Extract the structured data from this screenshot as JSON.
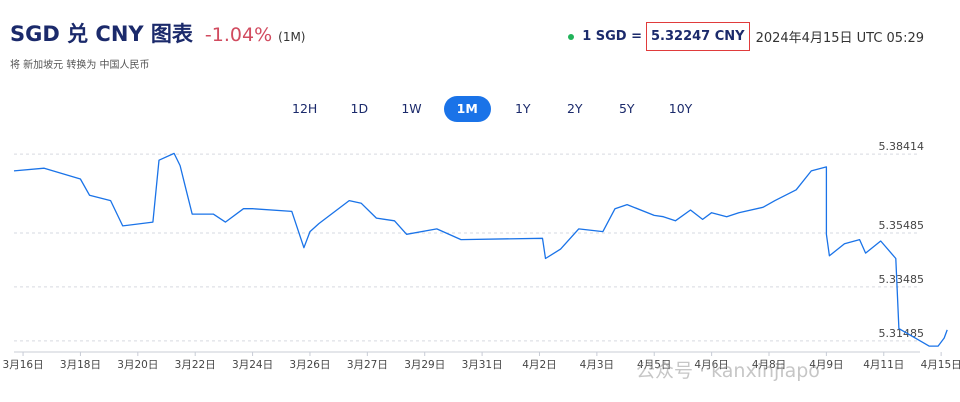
{
  "header": {
    "title": "SGD 兑 CNY 图表",
    "change": "-1.04%",
    "period": "(1M)",
    "subtitle": "将 新加坡元 转换为 中国人民币"
  },
  "rate": {
    "label": "1 SGD =",
    "value": "5.32247 CNY",
    "time": "2024年4月15日 UTC 05:29",
    "live_color": "#21b35a",
    "highlight_color": "#e03b3b"
  },
  "ranges": [
    "12H",
    "1D",
    "1W",
    "1M",
    "1Y",
    "2Y",
    "5Y",
    "10Y"
  ],
  "active_range": "1M",
  "watermark": "公众号 · kanxinjiapo",
  "chart_data": {
    "type": "line",
    "title": "",
    "xlabel": "",
    "ylabel": "",
    "line_color": "#1a73e8",
    "grid": "horizontal dashed",
    "y_ticks": [
      5.38414,
      5.35485,
      5.33485,
      5.31485
    ],
    "y_tick_labels": [
      "5.38414",
      "5.35485",
      "5.33485",
      "5.31485"
    ],
    "ylim": [
      5.3107,
      5.3879
    ],
    "x_tick_labels": [
      "3月16日",
      "3月18日",
      "3月20日",
      "3月22日",
      "3月24日",
      "3月26日",
      "3月27日",
      "3月29日",
      "3月31日",
      "4月2日",
      "4月3日",
      "4月5日",
      "4月6日",
      "4月8日",
      "4月9日",
      "4月11日",
      "4月15日"
    ],
    "xlim": [
      0,
      30
    ],
    "x_tick_positions": [
      0.3,
      2.2,
      4.1,
      6.0,
      7.9,
      9.8,
      11.7,
      13.6,
      15.5,
      17.4,
      19.3,
      21.2,
      23.1,
      25.0,
      26.9,
      28.8,
      30.7
    ],
    "x": [
      0.0,
      1.0,
      2.2,
      2.5,
      3.2,
      3.6,
      4.6,
      4.8,
      5.3,
      5.5,
      5.7,
      5.9,
      6.6,
      7.0,
      7.6,
      7.9,
      9.2,
      9.6,
      9.8,
      10.1,
      11.1,
      11.5,
      12.0,
      12.6,
      13.0,
      14.0,
      14.8,
      17.5,
      17.6,
      18.1,
      18.7,
      19.5,
      19.9,
      20.3,
      21.2,
      21.5,
      21.9,
      22.4,
      22.8,
      23.1,
      23.6,
      24.0,
      24.8,
      25.2,
      25.9,
      26.4,
      26.9,
      26.9,
      27.0,
      27.5,
      28.0,
      28.2,
      28.7,
      29.2,
      29.3,
      30.3,
      30.6,
      30.8,
      30.9
    ],
    "y": [
      5.3779,
      5.3789,
      5.3749,
      5.3689,
      5.3669,
      5.3575,
      5.3589,
      5.3819,
      5.3844,
      5.3799,
      5.3709,
      5.3619,
      5.3619,
      5.3589,
      5.3639,
      5.3639,
      5.3629,
      5.3494,
      5.3554,
      5.3584,
      5.3669,
      5.3659,
      5.3604,
      5.3594,
      5.3544,
      5.3564,
      5.3524,
      5.3529,
      5.3454,
      5.3489,
      5.3564,
      5.3554,
      5.3639,
      5.3654,
      5.3614,
      5.3609,
      5.3594,
      5.3634,
      5.3599,
      5.3624,
      5.3609,
      5.3624,
      5.3644,
      5.3669,
      5.3709,
      5.3779,
      5.3794,
      5.3544,
      5.3464,
      5.3509,
      5.3524,
      5.3474,
      5.3519,
      5.3454,
      5.3194,
      5.3129,
      5.3129,
      5.3159,
      5.3189
    ]
  }
}
